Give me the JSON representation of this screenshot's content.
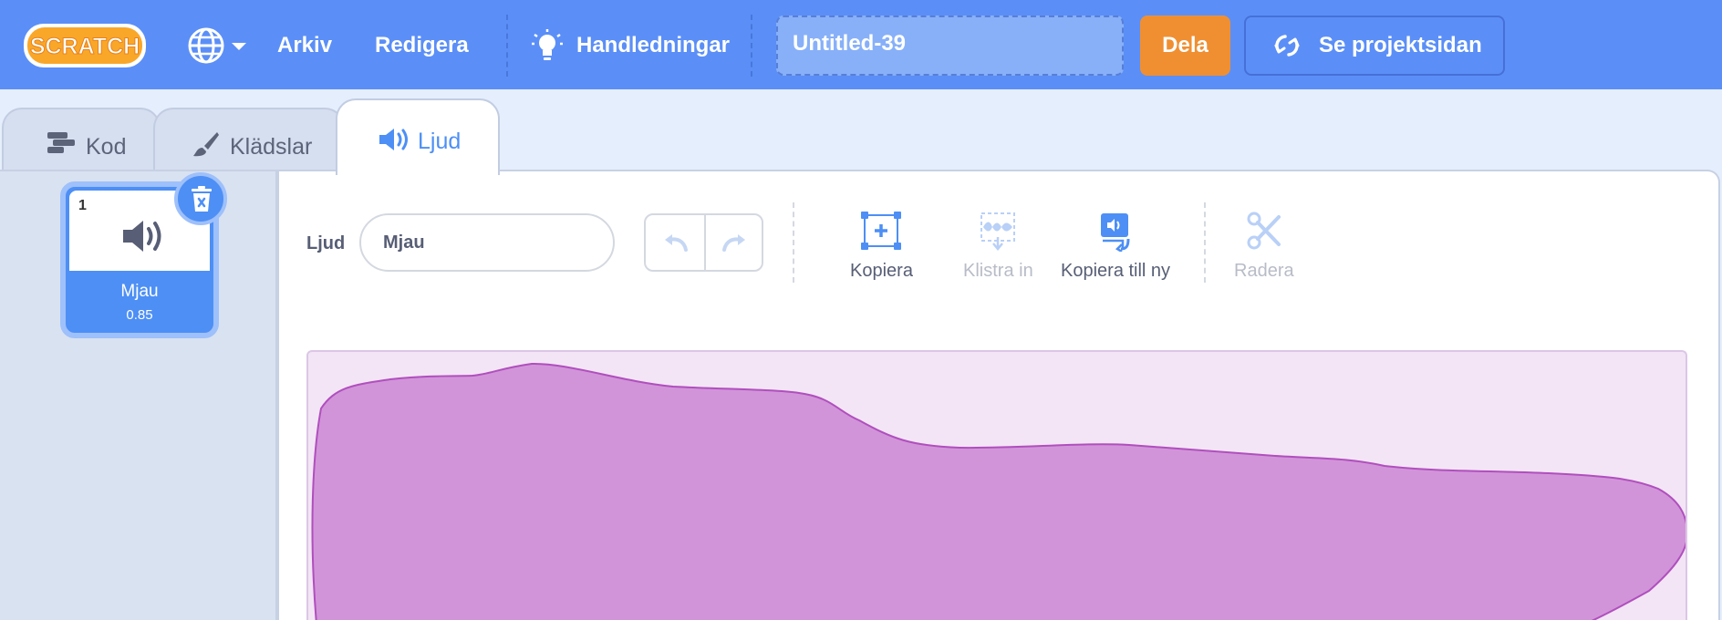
{
  "menu": {
    "logo_text": "SCRATCH",
    "file_label": "Arkiv",
    "edit_label": "Redigera",
    "tutorials_label": "Handledningar",
    "project_title": "Untitled-39",
    "share_label": "Dela",
    "see_project_label": "Se projektsidan"
  },
  "tabs": [
    {
      "label": "Kod",
      "active": false
    },
    {
      "label": "Klädslar",
      "active": false
    },
    {
      "label": "Ljud",
      "active": true
    }
  ],
  "sounds": [
    {
      "index": "1",
      "name": "Mjau",
      "duration": "0.85",
      "selected": true
    }
  ],
  "editor": {
    "sound_label": "Ljud",
    "sound_name": "Mjau",
    "tools": [
      {
        "label": "Kopiera",
        "icon": "copy-icon",
        "enabled": true
      },
      {
        "label": "Klistra in",
        "icon": "paste-icon",
        "enabled": false
      },
      {
        "label": "Kopiera till ny",
        "icon": "copy-to-new-icon",
        "enabled": true
      },
      {
        "label": "Radera",
        "icon": "scissors-icon",
        "enabled": false
      }
    ]
  },
  "colors": {
    "menu_bar": "#5b8ff7",
    "share_button": "#f08f32",
    "accent": "#4d8ff5",
    "waveform_fill": "#d294d9",
    "waveform_stroke": "#b04fbe",
    "waveform_background": "#f3e5f5"
  }
}
